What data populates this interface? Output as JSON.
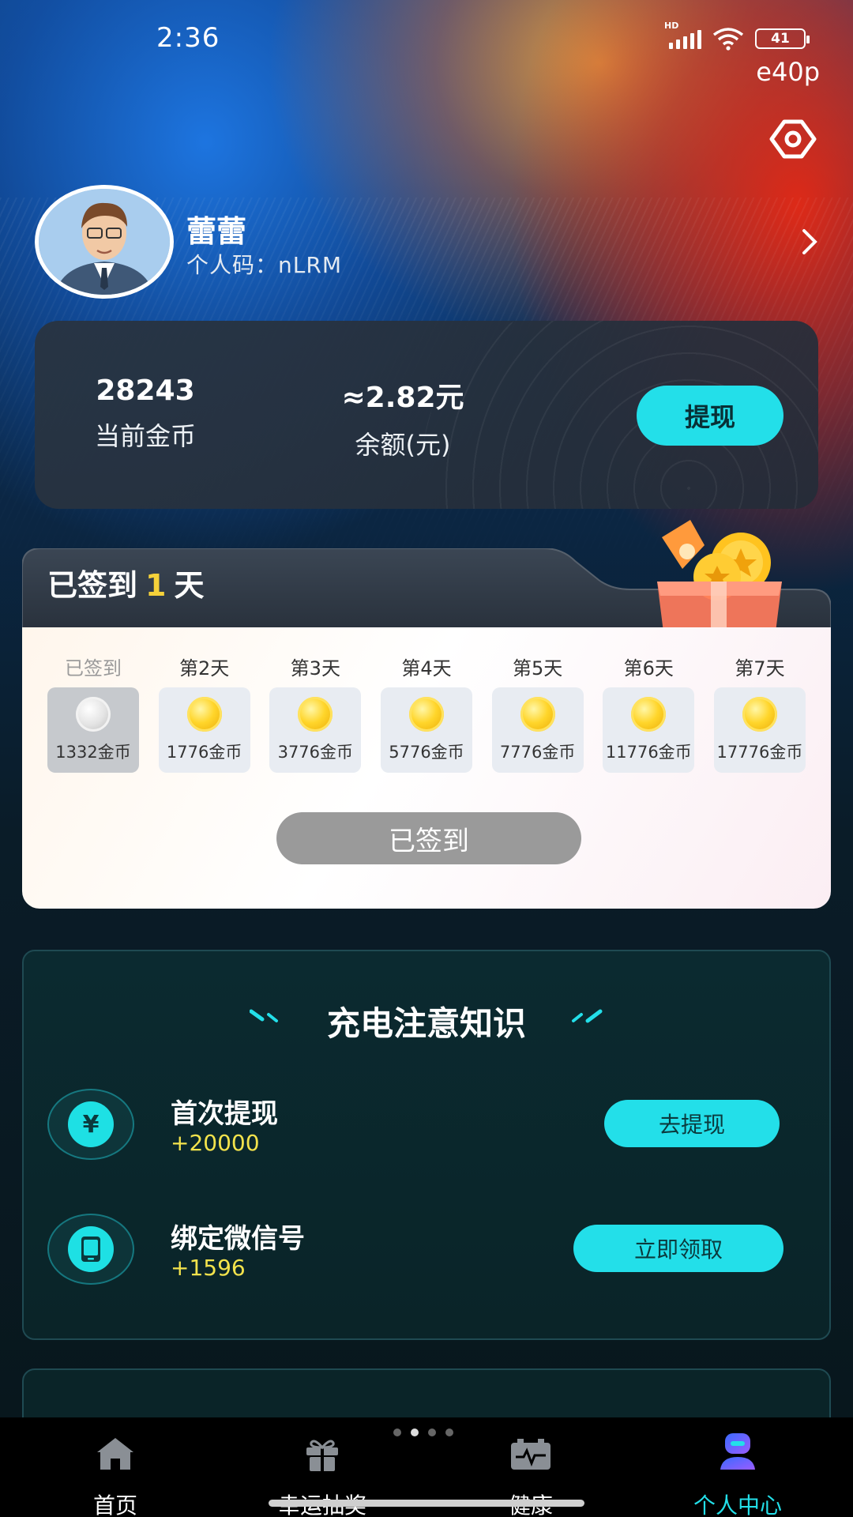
{
  "status_bar": {
    "time": "2:36",
    "network": "HD",
    "battery": "41",
    "sub": "e40p"
  },
  "profile": {
    "name": "蕾蕾",
    "code_label": "个人码：",
    "code_value": "nLRM"
  },
  "balance": {
    "coins_value": "28243",
    "coins_label": "当前金币",
    "money_value": "≈2.82元",
    "money_label": "余额(元)",
    "withdraw_label": "提现"
  },
  "signin": {
    "prefix": "已签到",
    "days": "1",
    "suffix": "天",
    "items": [
      {
        "label": "已签到",
        "amount": "1332金币",
        "signed": true
      },
      {
        "label": "第2天",
        "amount": "1776金币",
        "signed": false
      },
      {
        "label": "第3天",
        "amount": "3776金币",
        "signed": false
      },
      {
        "label": "第4天",
        "amount": "5776金币",
        "signed": false
      },
      {
        "label": "第5天",
        "amount": "7776金币",
        "signed": false
      },
      {
        "label": "第6天",
        "amount": "11776金币",
        "signed": false
      },
      {
        "label": "第7天",
        "amount": "17776金币",
        "signed": false
      }
    ],
    "button_label": "已签到"
  },
  "knowledge": {
    "title": "充电注意知识",
    "tasks": [
      {
        "name": "首次提现",
        "reward": "+20000",
        "button": "去提现",
        "icon": "yen-icon",
        "icon_text": "¥"
      },
      {
        "name": "绑定微信号",
        "reward": "+1596",
        "button": "立即领取",
        "icon": "phone-icon"
      }
    ]
  },
  "nav": {
    "items": [
      {
        "label": "首页",
        "icon": "home-icon"
      },
      {
        "label": "幸运抽奖",
        "icon": "gift-icon"
      },
      {
        "label": "健康",
        "icon": "battery-health-icon"
      },
      {
        "label": "个人中心",
        "icon": "user-center-icon",
        "active": true
      }
    ]
  },
  "colors": {
    "accent": "#23dfe9",
    "reward": "#f3e34c",
    "signin_highlight": "#f5d13a"
  }
}
